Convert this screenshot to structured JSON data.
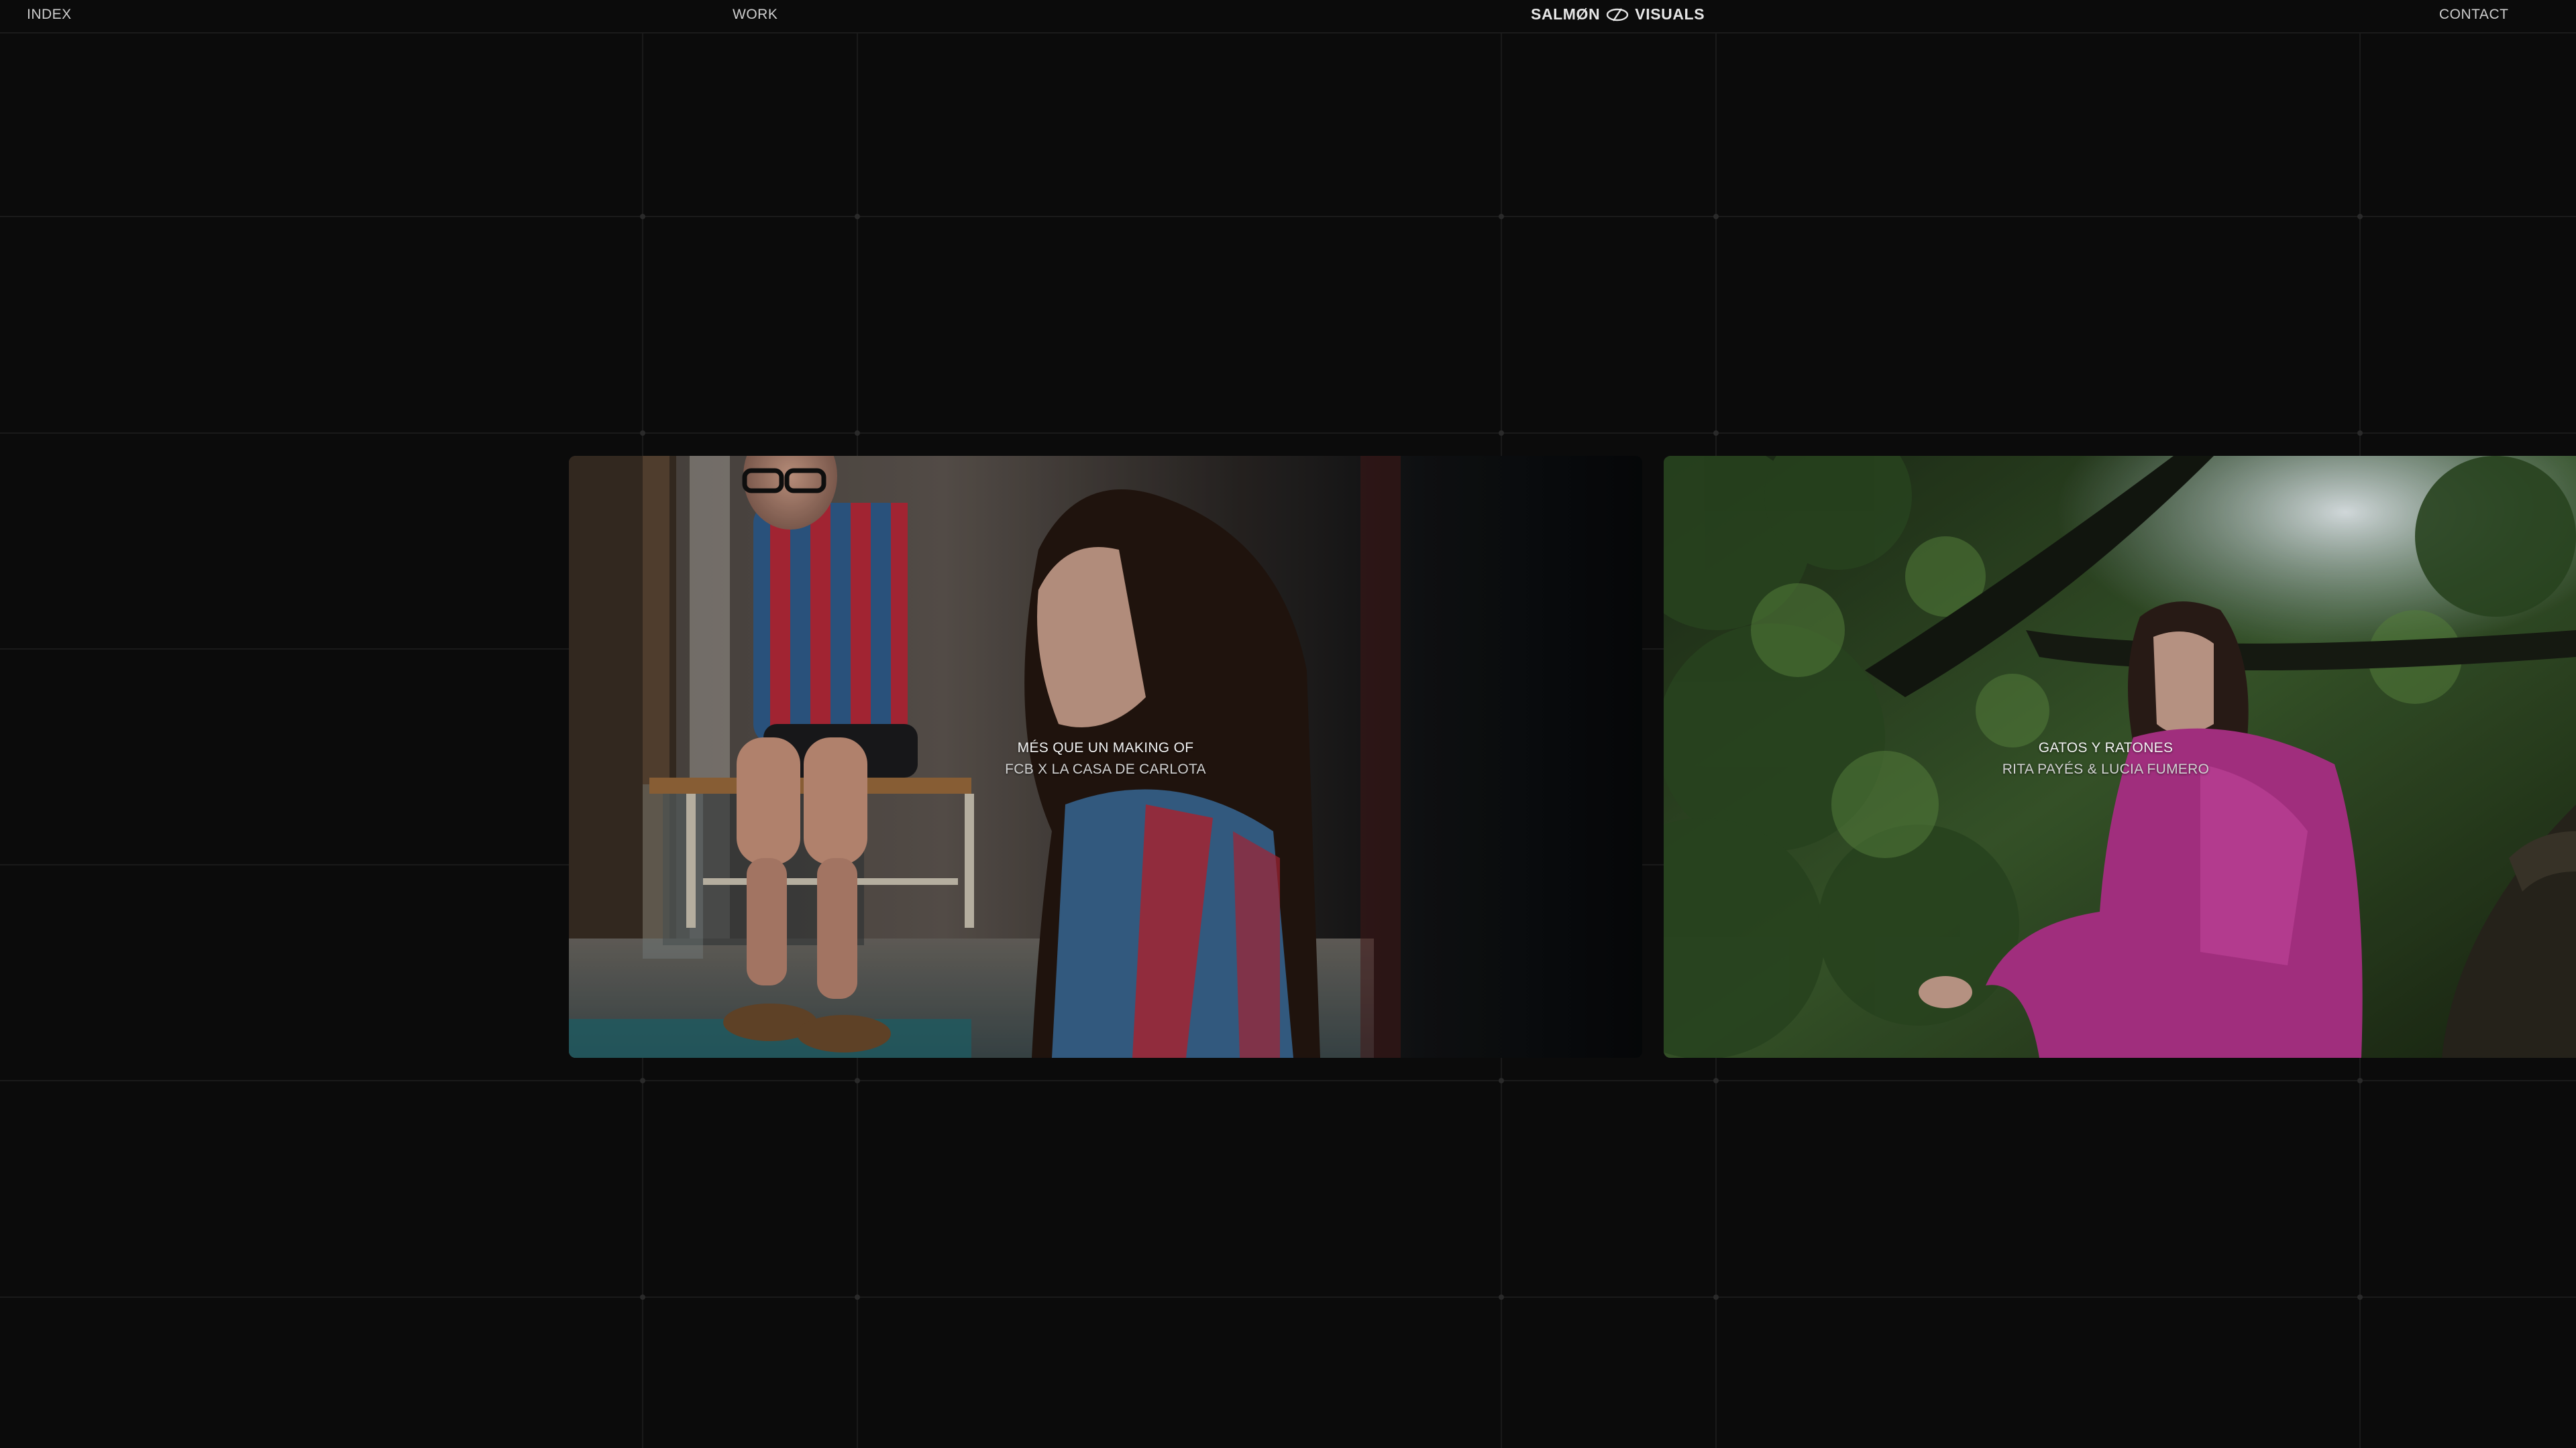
{
  "nav": {
    "index_label": "INDEX",
    "work_label": "WORK",
    "contact_label": "CONTACT"
  },
  "logo": {
    "left_text": "SALMØN",
    "right_text": "VISUALS"
  },
  "projects": [
    {
      "title": "MÉS QUE UN MAKING OF",
      "subtitle": "FCB X LA CASA DE CARLOTA"
    },
    {
      "title": "GATOS Y RATONES",
      "subtitle": "RITA PAYÉS & LUCIA FUMERO"
    }
  ],
  "colors": {
    "background": "#0b0b0b",
    "grid_line": "#1c1c1c",
    "text": "#d8d8d8"
  }
}
